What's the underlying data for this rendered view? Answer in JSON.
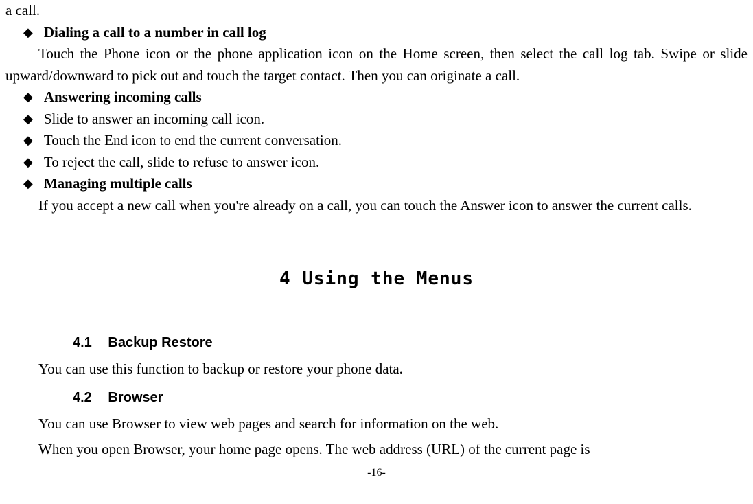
{
  "topFragment": "a call.",
  "bullets": [
    {
      "bold": true,
      "text": "Dialing a call to a number in call log"
    },
    {
      "para": "Touch the Phone icon or the phone application icon on the Home screen, then select the call log tab. Swipe or slide upward/downward to pick out and touch the target contact. Then you can originate a call."
    },
    {
      "bold": true,
      "text": "Answering incoming calls"
    },
    {
      "bold": false,
      "text": "Slide to answer an incoming call icon."
    },
    {
      "bold": false,
      "text": "Touch the End icon to end the current conversation."
    },
    {
      "bold": false,
      "text": "To reject the call, slide to refuse to answer icon."
    },
    {
      "bold": true,
      "text": "Managing multiple calls"
    },
    {
      "para": "If you accept a new call when you're already on a call, you can touch the Answer icon to answer the current calls."
    }
  ],
  "chapterTitle": "4 Using the Menus",
  "sections": [
    {
      "num": "4.1",
      "title": "Backup Restore",
      "body": "You can use this function to backup or restore your phone data."
    },
    {
      "num": "4.2",
      "title": "Browser",
      "body": "You can use Browser to view web pages and search for information on the web."
    }
  ],
  "lastPara": "When you open Browser, your home page opens. The web address (URL) of the current page is",
  "pageNumber": "-16-"
}
